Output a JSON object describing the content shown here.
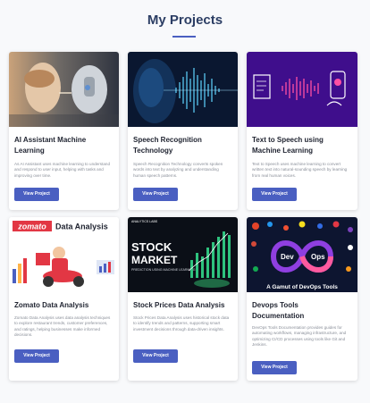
{
  "page": {
    "title": "My Projects"
  },
  "colors": {
    "accent": "#4a5fc1",
    "title": "#2c3e64",
    "card_bg": "#ffffff",
    "page_bg": "#f8f9fb"
  },
  "projects": [
    {
      "title": "AI Assistant Machine Learning",
      "description": "As AI Assistant uses machine learning to understand and respond to user input, helping with tasks and improving over time.",
      "button": "View Project",
      "image": "robot-face-image"
    },
    {
      "title": "Speech Recognition Technology",
      "description": "Speech Recognition Technology converts spoken words into text by analyzing and understanding human speech patterns.",
      "button": "View Project",
      "image": "sound-wave-image"
    },
    {
      "title": "Text to Speech using Machine Learning",
      "description": "Text to Speech uses machine learning to convert written text into natural-sounding speech by learning from real human voices.",
      "button": "View Project",
      "image": "text-to-speech-image"
    },
    {
      "title": "Zomato Data Analysis",
      "description": "Zomato Data Analysis uses data analysis techniques to explore restaurant trends, customer preferences, and ratings, helping businesses make informed decisions.",
      "button": "View Project",
      "image": "zomato-delivery-image",
      "image_text": {
        "brand": "zomato",
        "label": "Data Analysis"
      }
    },
    {
      "title": "Stock Prices Data Analysis",
      "description": "Stock Prices Data Analysis uses historical stock data to identify trends and patterns, supporting smart investment decisions through data-driven insights.",
      "button": "View Project",
      "image": "stock-market-image",
      "image_text": {
        "top": "STOCK",
        "bottom": "MARKET",
        "caption": "PREDICTION USING MACHINE LEARNING",
        "brand": "ANALYTICS LABS"
      }
    },
    {
      "title": "Devops Tools Documentation",
      "description": "DevOps Tools Documentation provides guides for automating workflows, managing infrastructure, and optimizing CI/CD processes using tools like Git and Jenkins.",
      "button": "View Project",
      "image": "devops-tools-image",
      "image_text": {
        "dev": "Dev",
        "ops": "Ops",
        "caption": "A Gamut of DevOps Tools"
      }
    }
  ]
}
